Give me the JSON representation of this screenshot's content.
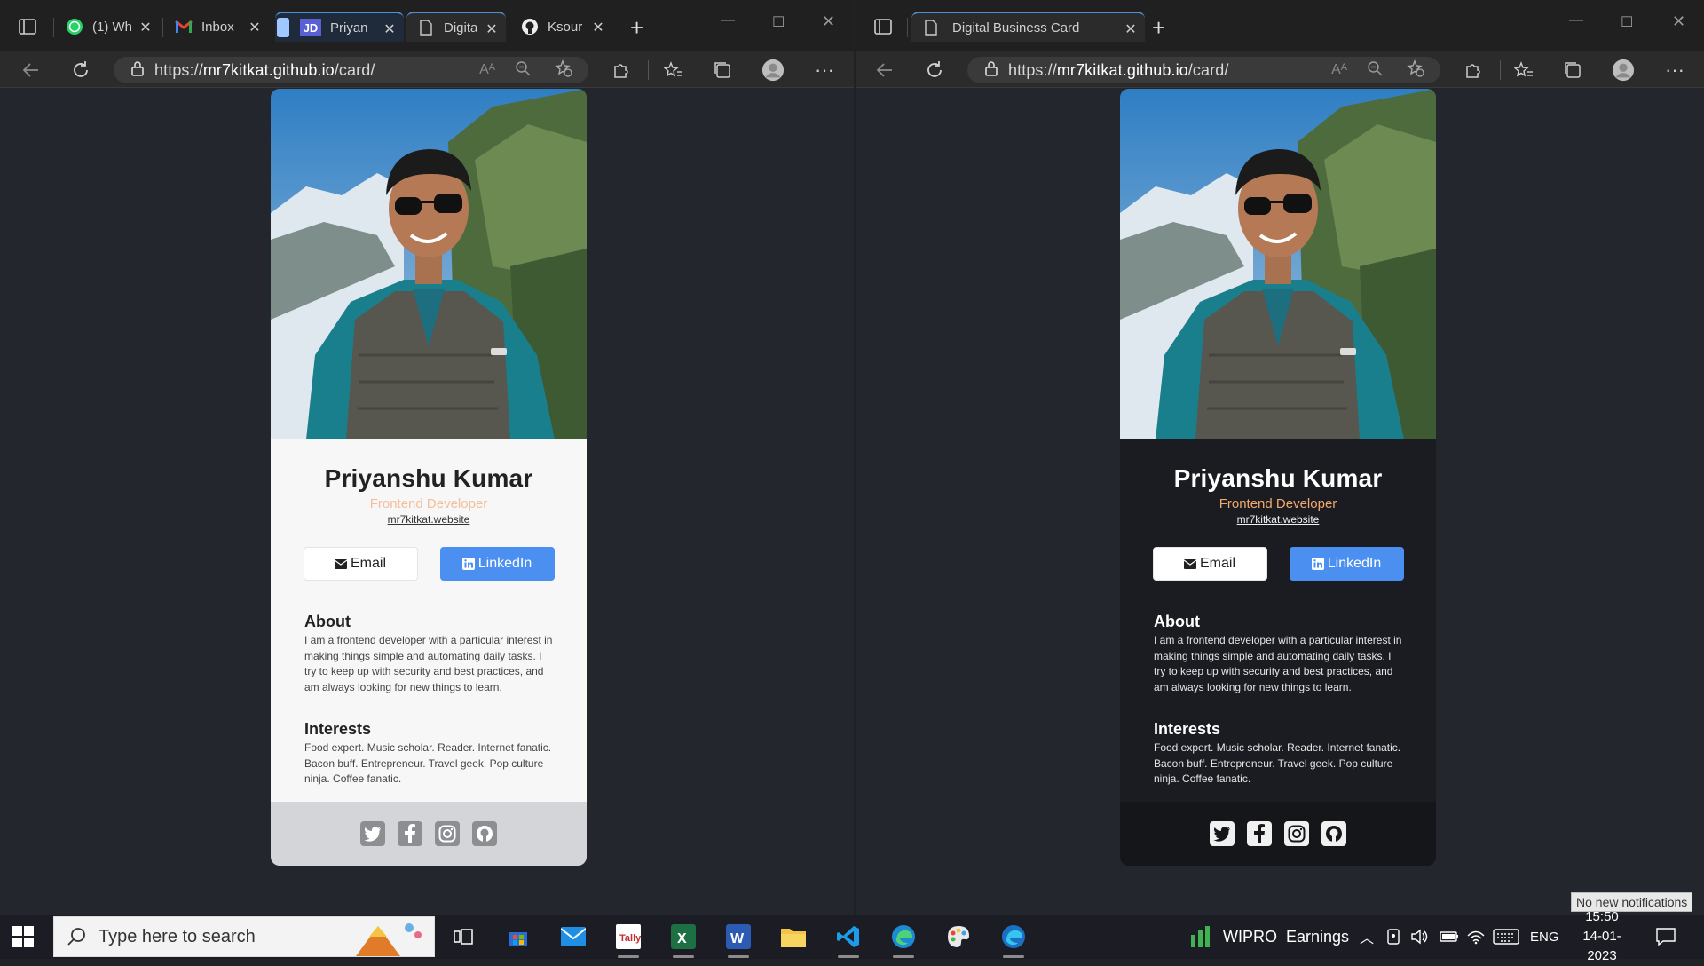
{
  "left_window": {
    "tabs": [
      {
        "label": "(1) Wh",
        "icon": "whatsapp-icon"
      },
      {
        "label": "Inbox",
        "icon": "gmail-icon"
      },
      {
        "label": "Priyan",
        "icon": "jd-icon"
      },
      {
        "label": "Digita",
        "icon": "page-icon"
      },
      {
        "label": "Ksour",
        "icon": "github-icon"
      }
    ],
    "url_prefix": "https://",
    "url_host": "mr7kitkat.github.io",
    "url_path": "/card/"
  },
  "right_window": {
    "tabs": [
      {
        "label": "Digital Business Card",
        "icon": "page-icon"
      }
    ],
    "url_prefix": "https://",
    "url_host": "mr7kitkat.github.io",
    "url_path": "/card/"
  },
  "card": {
    "name": "Priyanshu Kumar",
    "role": "Frontend Developer",
    "website": "mr7kitkat.website",
    "email_label": "Email",
    "linkedin_label": "LinkedIn",
    "about_heading": "About",
    "about_text": "I am a frontend developer with a particular interest in making things simple and automating daily tasks. I try to keep up with security and best practices, and am always looking for new things to learn.",
    "interests_heading": "Interests",
    "interests_text": "Food expert. Music scholar. Reader. Internet fanatic. Bacon buff. Entrepreneur. Travel geek. Pop culture ninja. Coffee fanatic.",
    "social_icons": [
      "twitter-icon",
      "facebook-icon",
      "instagram-icon",
      "github-icon"
    ]
  },
  "taskbar": {
    "search_placeholder": "Type here to search",
    "apps": [
      "task-view-icon",
      "microsoft-store-icon",
      "mail-icon",
      "tally-icon",
      "excel-icon",
      "word-icon",
      "file-explorer-icon",
      "vscode-icon",
      "edge-icon",
      "paint-icon",
      "edge-dev-icon"
    ],
    "stock_label": "WIPRO",
    "stock_detail": "Earnings",
    "language": "ENG",
    "time": "15:50",
    "date": "14-01-2023",
    "notification_tooltip": "No new notifications"
  },
  "colors": {
    "accent_blue": "#4b8ff0",
    "role_orange_light": "#f3bf99",
    "role_orange_dark": "#f3a86c",
    "page_bg": "#23262d"
  }
}
